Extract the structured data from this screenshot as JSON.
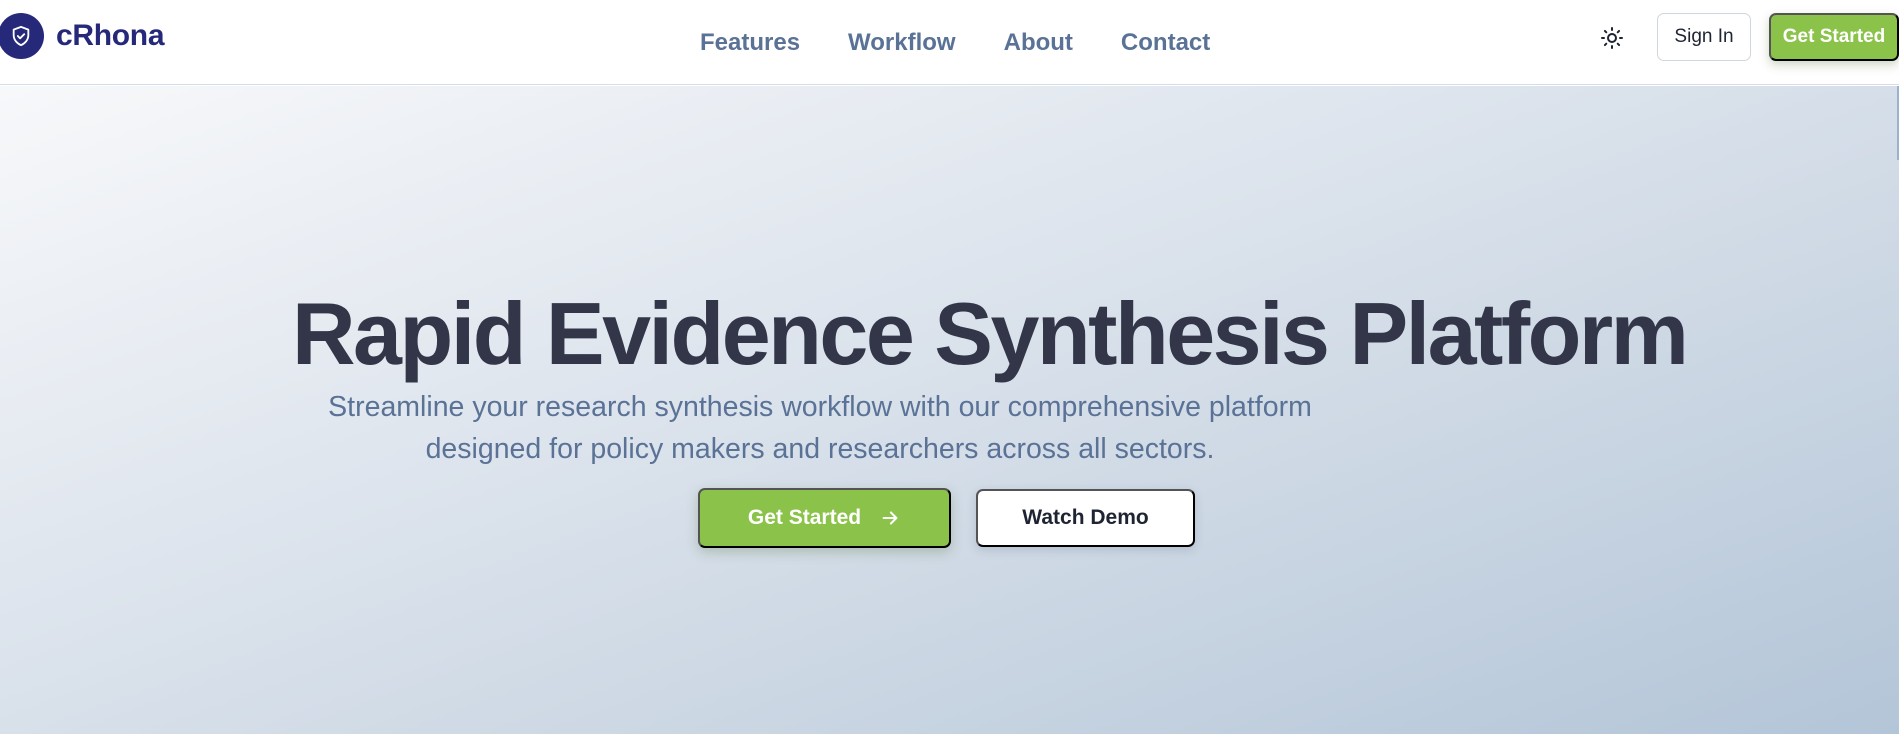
{
  "brand": {
    "name": "cRhona",
    "color": "#26287a"
  },
  "nav": {
    "items": [
      {
        "label": "Features"
      },
      {
        "label": "Workflow"
      },
      {
        "label": "About"
      },
      {
        "label": "Contact"
      }
    ]
  },
  "header_actions": {
    "theme_icon": "sun-icon",
    "sign_in_label": "Sign In",
    "get_started_label": "Get Started"
  },
  "hero": {
    "title": "Rapid Evidence Synthesis Platform",
    "subtitle_line1": "Streamline your research synthesis workflow with our comprehensive platform",
    "subtitle_line2": "designed for policy makers and researchers across all sectors.",
    "primary_label": "Get Started",
    "primary_icon": "arrow-right-icon",
    "secondary_label": "Watch Demo"
  },
  "colors": {
    "accent": "#8bc34a",
    "title_text": "#323648",
    "muted_text": "#5a7296"
  }
}
